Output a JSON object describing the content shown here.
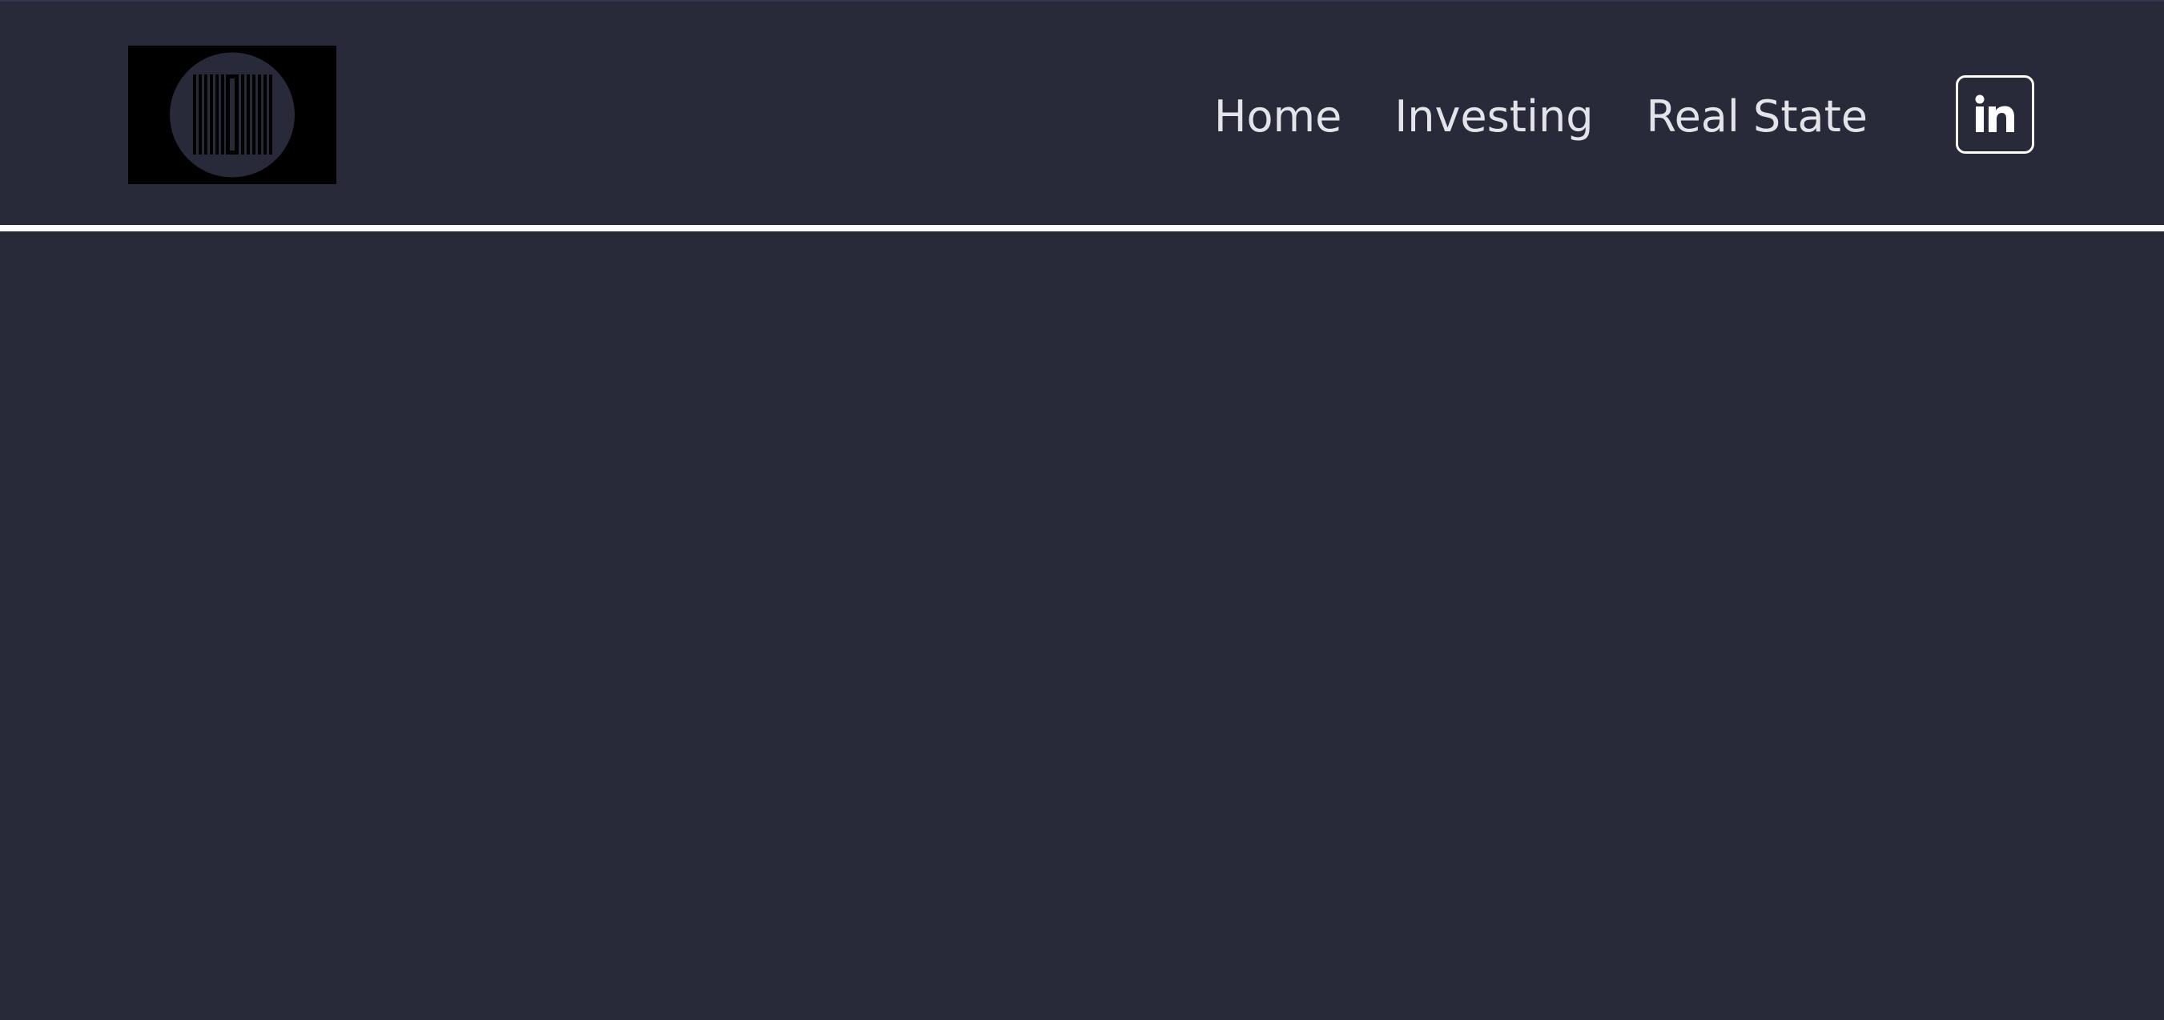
{
  "nav": {
    "links": [
      {
        "label": "Home"
      },
      {
        "label": "Investing"
      },
      {
        "label": "Real State"
      }
    ],
    "social": {
      "icon": "linkedin-icon"
    },
    "logo": {
      "icon": "logo-mark-icon"
    }
  },
  "colors": {
    "background": "#282a39",
    "nav_text": "#e3e4ea",
    "divider": "#ffffff",
    "logo_background": "#000000"
  }
}
